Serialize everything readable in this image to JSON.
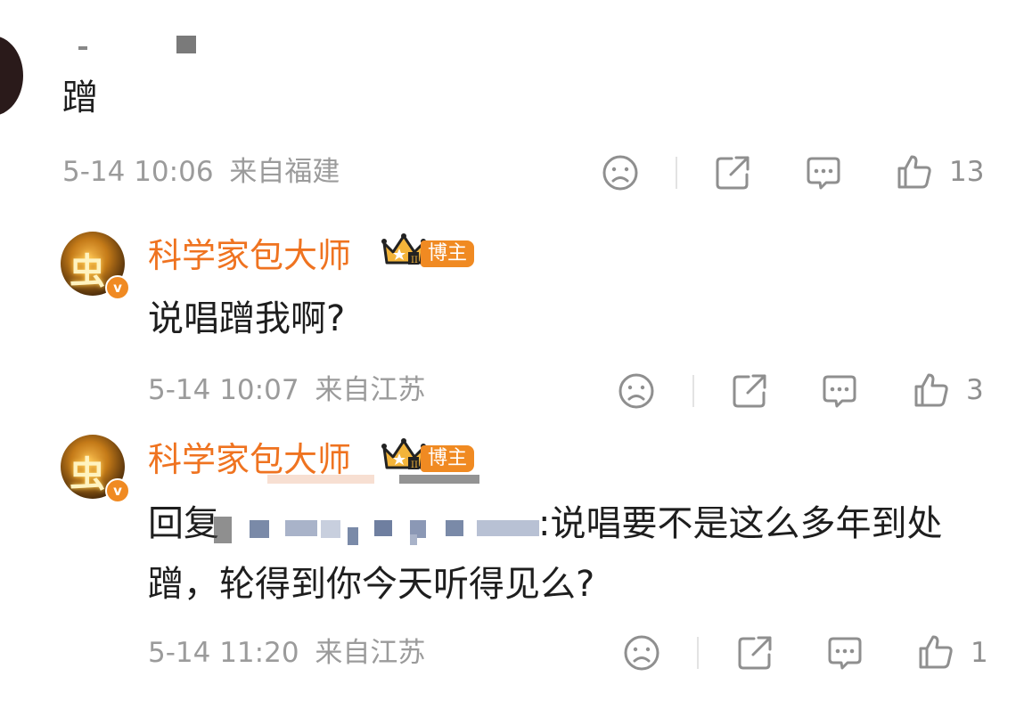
{
  "comment1": {
    "text": "蹭",
    "time": "5-14 10:06",
    "location": "来自福建",
    "like_count": "13"
  },
  "reply1": {
    "user": "科学家包大师",
    "tag": "博主",
    "text": "说唱蹭我啊?",
    "time": "5-14 10:07",
    "location": "来自江苏",
    "like_count": "3"
  },
  "reply2": {
    "user": "科学家包大师",
    "tag": "博主",
    "reply_prefix": "回复",
    "text_line1": ":说唱要不是这么多年到处",
    "text_line2": "蹭，轮得到你今天听得见么?",
    "time": "5-14 11:20",
    "location": "来自江苏",
    "like_count": "1"
  },
  "colors": {
    "username": "#ef7320",
    "badge": "#f08a22",
    "meta": "#9b9b9b"
  },
  "icons": [
    "sad-face-icon",
    "share-icon",
    "comment-icon",
    "thumbs-up-icon",
    "crown-icon",
    "verified-icon"
  ]
}
